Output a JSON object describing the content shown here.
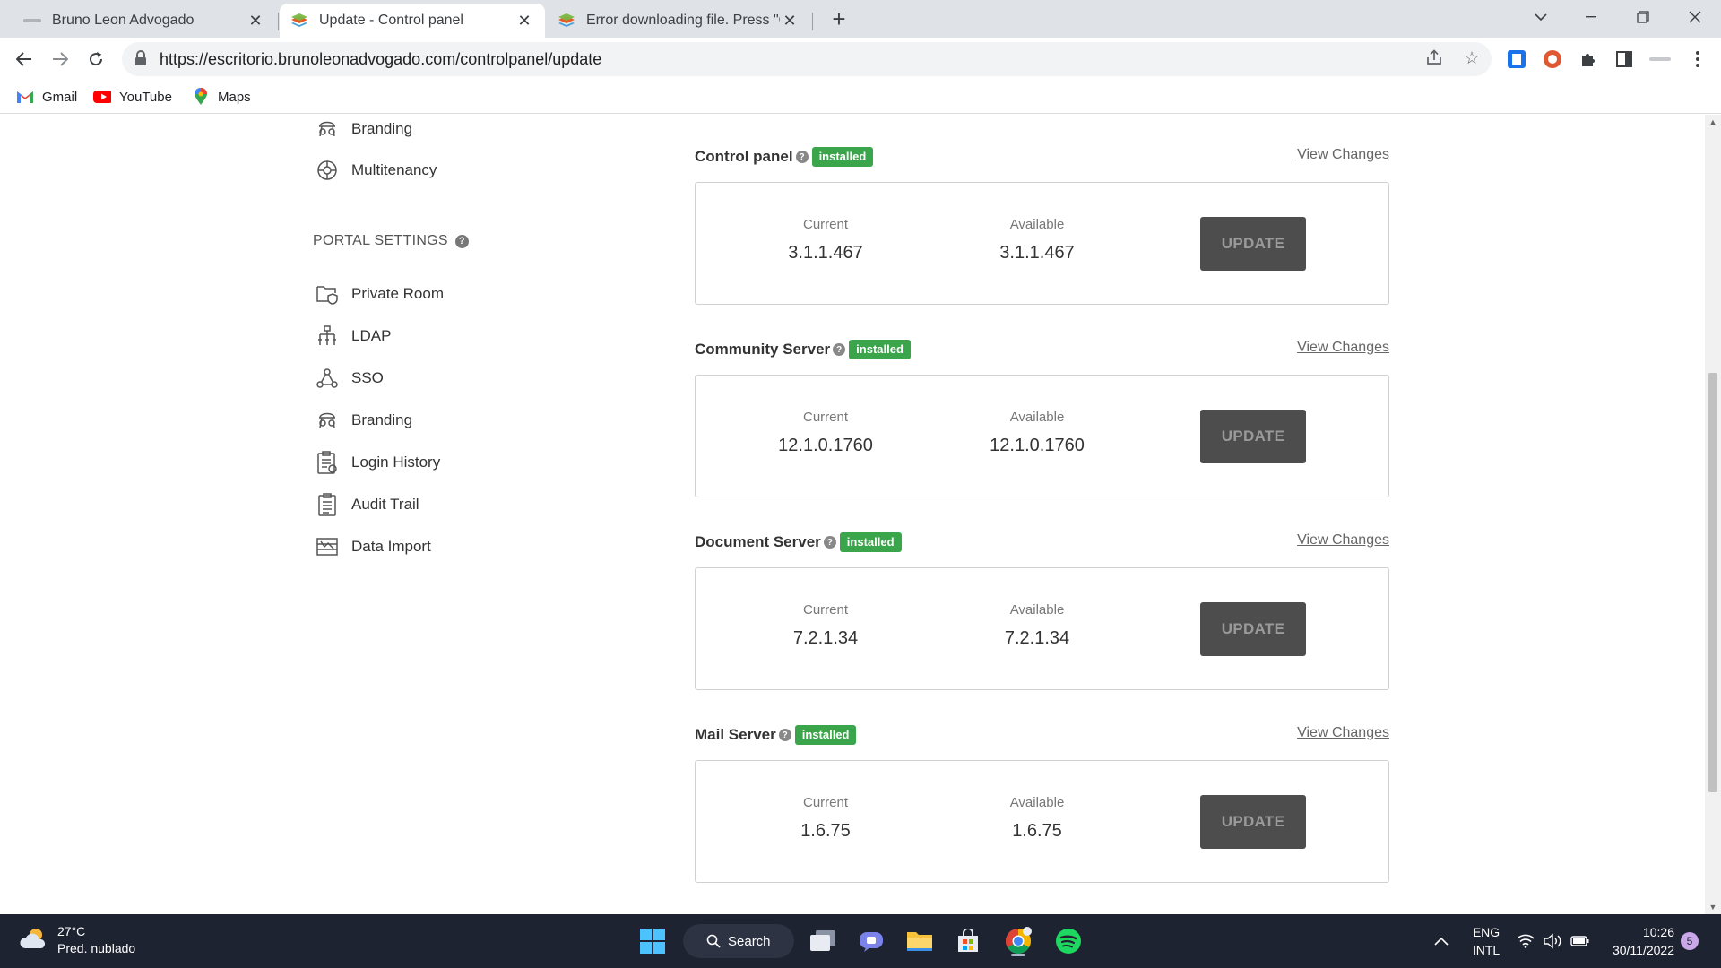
{
  "browser": {
    "tabs": [
      {
        "title": "Bruno Leon Advogado",
        "active": false
      },
      {
        "title": "Update - Control panel",
        "active": true
      },
      {
        "title": "Error downloading file. Press \"OK",
        "active": false
      }
    ],
    "url": "https://escritorio.brunoleonadvogado.com/controlpanel/update",
    "bookmarks": [
      "Gmail",
      "YouTube",
      "Maps"
    ]
  },
  "sidebar": {
    "top_items": [
      "Branding",
      "Multitenancy"
    ],
    "portal_settings_heading": "PORTAL SETTINGS",
    "portal_items": [
      "Private Room",
      "LDAP",
      "SSO",
      "Branding",
      "Login History",
      "Audit Trail",
      "Data Import"
    ]
  },
  "modules": [
    {
      "name": "Control panel",
      "status": "installed",
      "view_changes": "View Changes",
      "current_label": "Current",
      "current": "3.1.1.467",
      "available_label": "Available",
      "available": "3.1.1.467",
      "update_label": "UPDATE"
    },
    {
      "name": "Community Server",
      "status": "installed",
      "view_changes": "View Changes",
      "current_label": "Current",
      "current": "12.1.0.1760",
      "available_label": "Available",
      "available": "12.1.0.1760",
      "update_label": "UPDATE"
    },
    {
      "name": "Document Server",
      "status": "installed",
      "view_changes": "View Changes",
      "current_label": "Current",
      "current": "7.2.1.34",
      "available_label": "Available",
      "available": "7.2.1.34",
      "update_label": "UPDATE"
    },
    {
      "name": "Mail Server",
      "status": "installed",
      "view_changes": "View Changes",
      "current_label": "Current",
      "current": "1.6.75",
      "available_label": "Available",
      "available": "1.6.75",
      "update_label": "UPDATE"
    }
  ],
  "taskbar": {
    "weather_temp": "27°C",
    "weather_desc": "Pred. nublado",
    "search_label": "Search",
    "lang_1": "ENG",
    "lang_2": "INTL",
    "time": "10:26",
    "date": "30/11/2022",
    "notification_count": "5"
  },
  "colors": {
    "installed_badge": "#3aa54a",
    "update_button": "#4d4d4d",
    "taskbar": "#1e2331",
    "tabstrip": "#dfe3e7"
  }
}
